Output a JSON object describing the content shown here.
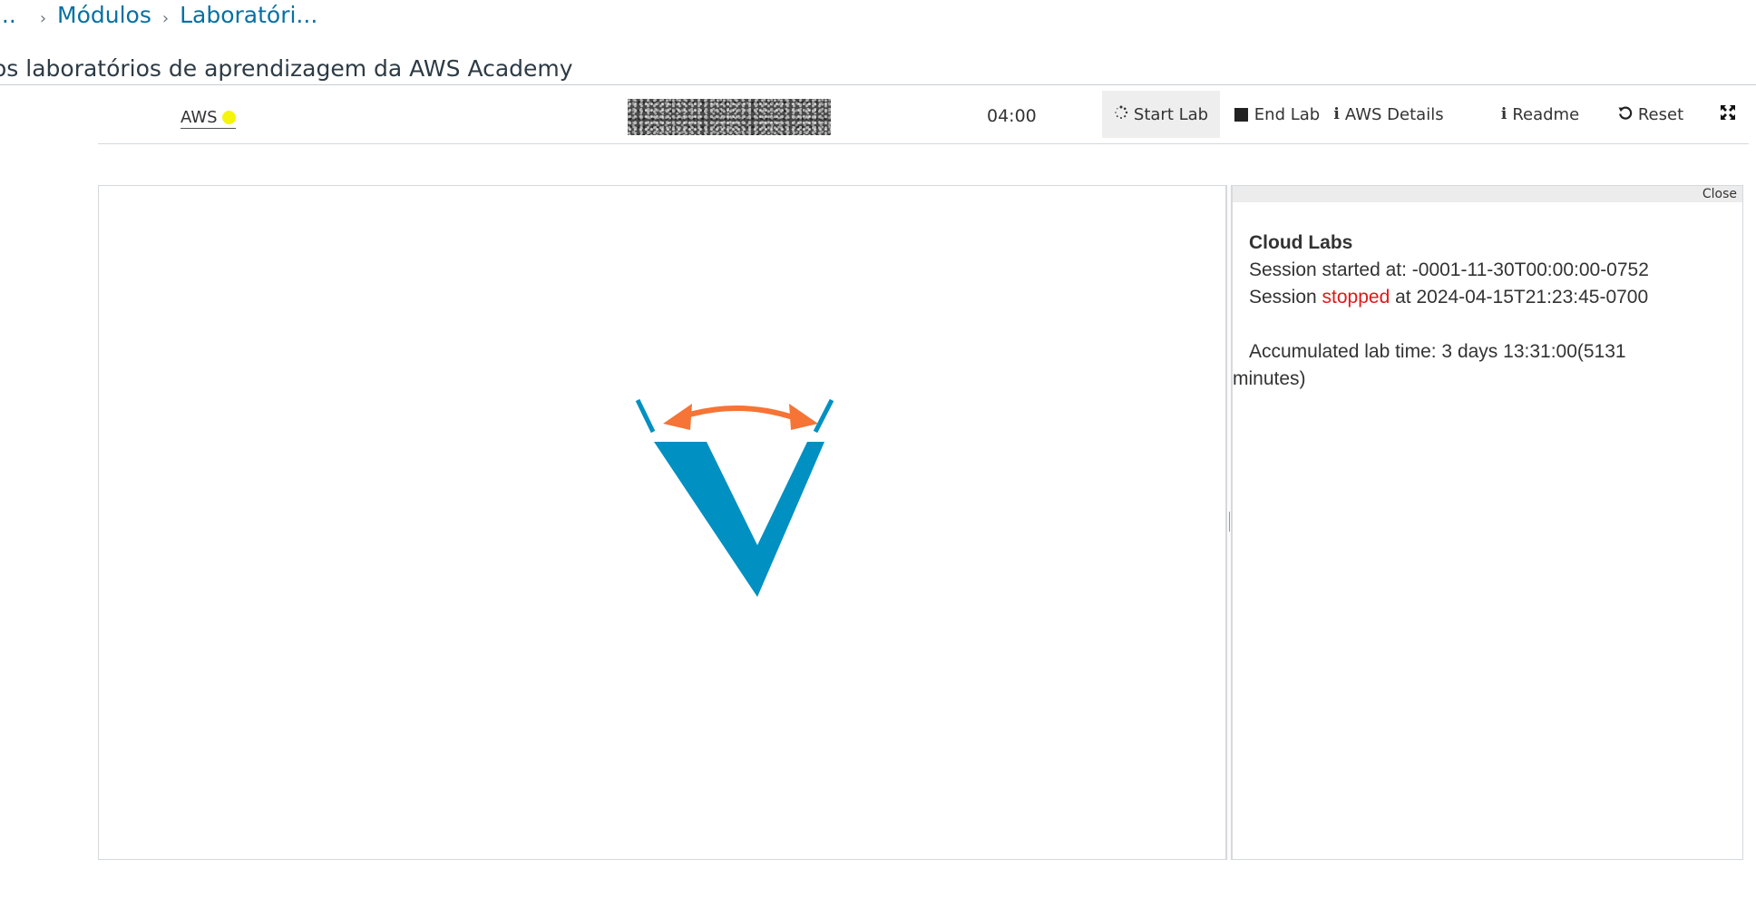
{
  "breadcrumb": {
    "items": [
      {
        "label": "r..."
      },
      {
        "label": "Módulos"
      },
      {
        "label": "Laboratóri..."
      }
    ],
    "separator": ">"
  },
  "page": {
    "title": "os laboratórios de aprendizagem da AWS Academy"
  },
  "toolbar": {
    "aws_label": "AWS",
    "aws_status_color": "#f5f50c",
    "timer": "04:00",
    "start_lab": "Start Lab",
    "end_lab": "End Lab",
    "aws_details": "AWS Details",
    "readme": "Readme",
    "reset": "Reset",
    "icons": {
      "start_lab": "spinner-icon",
      "end_lab": "stop-icon",
      "aws_details": "info-icon",
      "readme": "info-icon",
      "reset": "reset-icon",
      "fullscreen": "expand-icon"
    }
  },
  "info_panel": {
    "close_label": "Close",
    "title": "Cloud Labs",
    "session_started_label": "Session started at: ",
    "session_started_value": "-0001-11-30T00:00:00-0752",
    "session_label": "Session ",
    "session_state": "stopped",
    "session_state_color": "#e01818",
    "session_at": " at 2024-04-15T21:23:45-0700",
    "accumulated_label": "Accumulated lab time: 3 days 13:31:00(5131",
    "accumulated_cont": "minutes)"
  },
  "colors": {
    "link": "#0770a3",
    "logo_blue": "#0090c1",
    "logo_orange": "#f57436"
  }
}
